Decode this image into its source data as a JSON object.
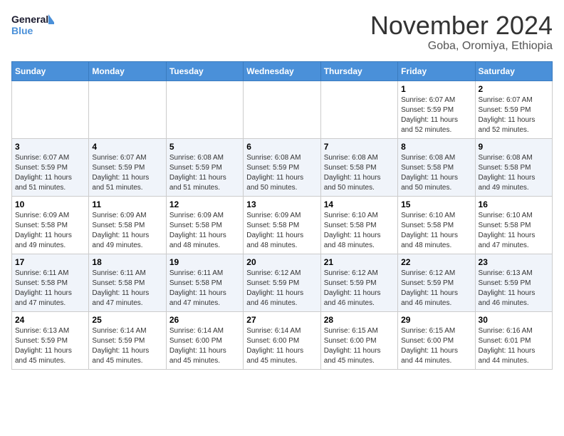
{
  "header": {
    "logo_line1": "General",
    "logo_line2": "Blue",
    "month": "November 2024",
    "location": "Goba, Oromiya, Ethiopia"
  },
  "weekdays": [
    "Sunday",
    "Monday",
    "Tuesday",
    "Wednesday",
    "Thursday",
    "Friday",
    "Saturday"
  ],
  "weeks": [
    [
      {
        "day": "",
        "info": ""
      },
      {
        "day": "",
        "info": ""
      },
      {
        "day": "",
        "info": ""
      },
      {
        "day": "",
        "info": ""
      },
      {
        "day": "",
        "info": ""
      },
      {
        "day": "1",
        "info": "Sunrise: 6:07 AM\nSunset: 5:59 PM\nDaylight: 11 hours\nand 52 minutes."
      },
      {
        "day": "2",
        "info": "Sunrise: 6:07 AM\nSunset: 5:59 PM\nDaylight: 11 hours\nand 52 minutes."
      }
    ],
    [
      {
        "day": "3",
        "info": "Sunrise: 6:07 AM\nSunset: 5:59 PM\nDaylight: 11 hours\nand 51 minutes."
      },
      {
        "day": "4",
        "info": "Sunrise: 6:07 AM\nSunset: 5:59 PM\nDaylight: 11 hours\nand 51 minutes."
      },
      {
        "day": "5",
        "info": "Sunrise: 6:08 AM\nSunset: 5:59 PM\nDaylight: 11 hours\nand 51 minutes."
      },
      {
        "day": "6",
        "info": "Sunrise: 6:08 AM\nSunset: 5:59 PM\nDaylight: 11 hours\nand 50 minutes."
      },
      {
        "day": "7",
        "info": "Sunrise: 6:08 AM\nSunset: 5:58 PM\nDaylight: 11 hours\nand 50 minutes."
      },
      {
        "day": "8",
        "info": "Sunrise: 6:08 AM\nSunset: 5:58 PM\nDaylight: 11 hours\nand 50 minutes."
      },
      {
        "day": "9",
        "info": "Sunrise: 6:08 AM\nSunset: 5:58 PM\nDaylight: 11 hours\nand 49 minutes."
      }
    ],
    [
      {
        "day": "10",
        "info": "Sunrise: 6:09 AM\nSunset: 5:58 PM\nDaylight: 11 hours\nand 49 minutes."
      },
      {
        "day": "11",
        "info": "Sunrise: 6:09 AM\nSunset: 5:58 PM\nDaylight: 11 hours\nand 49 minutes."
      },
      {
        "day": "12",
        "info": "Sunrise: 6:09 AM\nSunset: 5:58 PM\nDaylight: 11 hours\nand 48 minutes."
      },
      {
        "day": "13",
        "info": "Sunrise: 6:09 AM\nSunset: 5:58 PM\nDaylight: 11 hours\nand 48 minutes."
      },
      {
        "day": "14",
        "info": "Sunrise: 6:10 AM\nSunset: 5:58 PM\nDaylight: 11 hours\nand 48 minutes."
      },
      {
        "day": "15",
        "info": "Sunrise: 6:10 AM\nSunset: 5:58 PM\nDaylight: 11 hours\nand 48 minutes."
      },
      {
        "day": "16",
        "info": "Sunrise: 6:10 AM\nSunset: 5:58 PM\nDaylight: 11 hours\nand 47 minutes."
      }
    ],
    [
      {
        "day": "17",
        "info": "Sunrise: 6:11 AM\nSunset: 5:58 PM\nDaylight: 11 hours\nand 47 minutes."
      },
      {
        "day": "18",
        "info": "Sunrise: 6:11 AM\nSunset: 5:58 PM\nDaylight: 11 hours\nand 47 minutes."
      },
      {
        "day": "19",
        "info": "Sunrise: 6:11 AM\nSunset: 5:58 PM\nDaylight: 11 hours\nand 47 minutes."
      },
      {
        "day": "20",
        "info": "Sunrise: 6:12 AM\nSunset: 5:59 PM\nDaylight: 11 hours\nand 46 minutes."
      },
      {
        "day": "21",
        "info": "Sunrise: 6:12 AM\nSunset: 5:59 PM\nDaylight: 11 hours\nand 46 minutes."
      },
      {
        "day": "22",
        "info": "Sunrise: 6:12 AM\nSunset: 5:59 PM\nDaylight: 11 hours\nand 46 minutes."
      },
      {
        "day": "23",
        "info": "Sunrise: 6:13 AM\nSunset: 5:59 PM\nDaylight: 11 hours\nand 46 minutes."
      }
    ],
    [
      {
        "day": "24",
        "info": "Sunrise: 6:13 AM\nSunset: 5:59 PM\nDaylight: 11 hours\nand 45 minutes."
      },
      {
        "day": "25",
        "info": "Sunrise: 6:14 AM\nSunset: 5:59 PM\nDaylight: 11 hours\nand 45 minutes."
      },
      {
        "day": "26",
        "info": "Sunrise: 6:14 AM\nSunset: 6:00 PM\nDaylight: 11 hours\nand 45 minutes."
      },
      {
        "day": "27",
        "info": "Sunrise: 6:14 AM\nSunset: 6:00 PM\nDaylight: 11 hours\nand 45 minutes."
      },
      {
        "day": "28",
        "info": "Sunrise: 6:15 AM\nSunset: 6:00 PM\nDaylight: 11 hours\nand 45 minutes."
      },
      {
        "day": "29",
        "info": "Sunrise: 6:15 AM\nSunset: 6:00 PM\nDaylight: 11 hours\nand 44 minutes."
      },
      {
        "day": "30",
        "info": "Sunrise: 6:16 AM\nSunset: 6:01 PM\nDaylight: 11 hours\nand 44 minutes."
      }
    ]
  ]
}
